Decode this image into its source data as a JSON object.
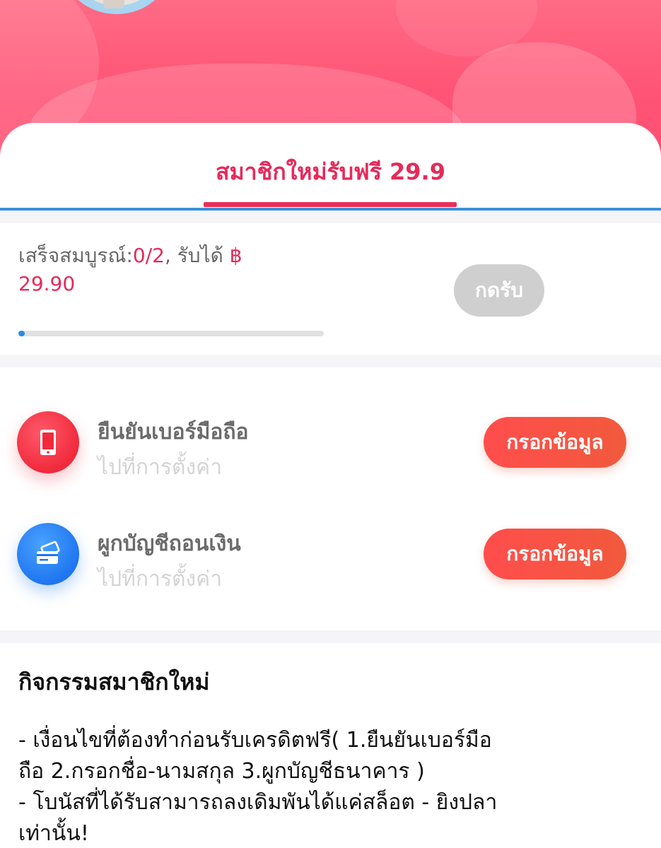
{
  "colors": {
    "accent": "#e62a5a",
    "hero_gradient_top": "#ff6b84",
    "hero_gradient_bottom": "#ff4f73",
    "tab_line": "#3b8fd6",
    "action_button": "#f15a3c",
    "disabled_button": "#cfcfcf",
    "progress_fill": "#2a8be8"
  },
  "tab": {
    "label": "สมาชิกใหม่รับฟรี 29.9"
  },
  "progress": {
    "complete_label": "เสร็จสมบูรณ์:",
    "complete_value": "0/2",
    "receive_label": ", รับได้ ",
    "currency": "฿",
    "amount": "29.90",
    "claim_button": "กดรับ",
    "fill_fraction": 0.02
  },
  "tasks": [
    {
      "title": "ยืนยันเบอร์มือถือ",
      "subtitle": "ไปที่การตั้งค่า",
      "button": "กรอกข้อมูล",
      "icon": "phone-icon"
    },
    {
      "title": "ผูกบัญชีถอนเงิน",
      "subtitle": "ไปที่การตั้งค่า",
      "button": "กรอกข้อมูล",
      "icon": "card-icon"
    }
  ],
  "info": {
    "title": "กิจกรรมสมาชิกใหม่",
    "lines": [
      "- เงื่อนไขที่ต้องทำก่อนรับเครดิตฟรี( 1.ยืนยันเบอร์มือ",
      "ถือ  2.กรอกชื่อ-นามสกุล  3.ผูกบัญชีธนาคาร )",
      "- โบนัสที่ได้รับสามารถลงเดิมพันได้แค่สล็อต - ยิงปลา",
      "เท่านั้น!"
    ]
  }
}
